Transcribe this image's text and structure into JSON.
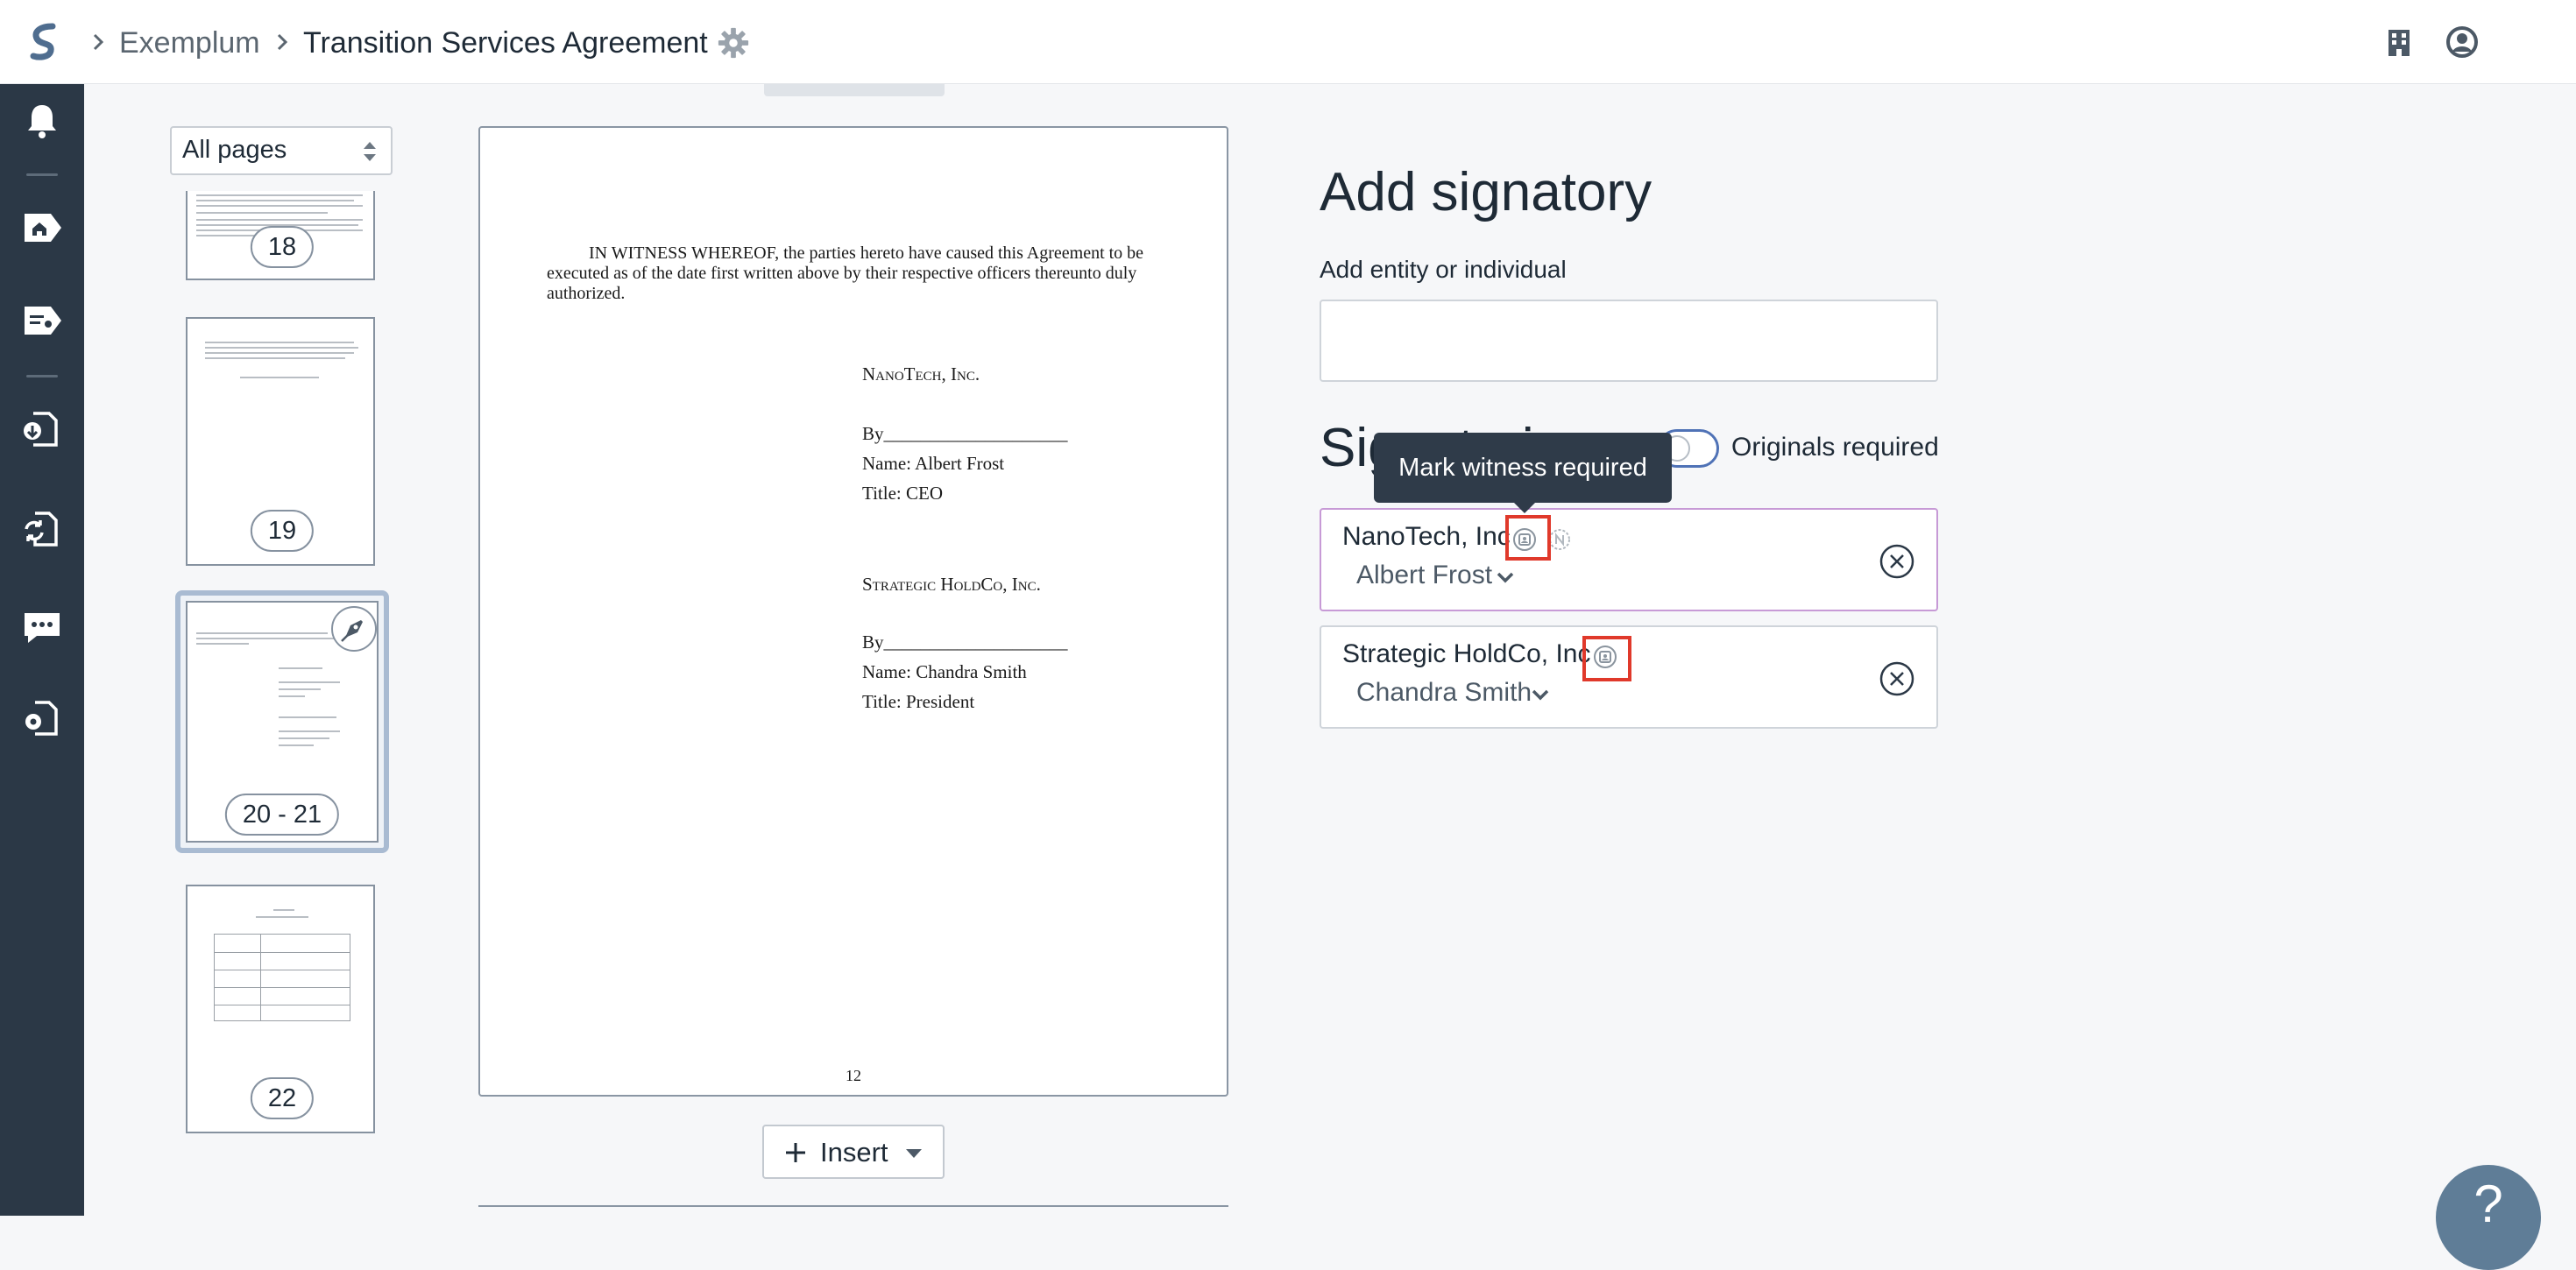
{
  "breadcrumb": {
    "org": "Exemplum",
    "document": "Transition Services Agreement"
  },
  "icons": {
    "logo": "app-logo-icon",
    "settings": "gear-icon",
    "building": "building-icon",
    "account": "user-circle-icon"
  },
  "nav": {
    "items": [
      "bell-icon",
      "home-icon",
      "tag-document-icon",
      "document-download-icon",
      "document-sync-icon",
      "chat-icon",
      "document-settings-icon"
    ]
  },
  "thumbnails": {
    "filter": {
      "selected": "All pages"
    },
    "pages": [
      {
        "label": "18"
      },
      {
        "label": "19"
      },
      {
        "label": "20 - 21"
      },
      {
        "label": "22"
      }
    ]
  },
  "document": {
    "witness_paragraph": "IN WITNESS WHEREOF, the parties hereto have caused this Agreement to be executed as of the date first written above by their respective officers thereunto duly authorized.",
    "party1": {
      "name": "NanoTech, Inc.",
      "by": "By____________________",
      "signer": "Name: Albert Frost",
      "title": "Title: CEO"
    },
    "party2": {
      "name": "Strategic HoldCo, Inc.",
      "by": "By____________________",
      "signer": "Name: Chandra Smith",
      "title": "Title: President"
    },
    "page_number": "12"
  },
  "insert_button": {
    "label": "Insert"
  },
  "panel": {
    "title": "Add signatory",
    "entity_label": "Add entity or individual",
    "entity_value": "",
    "signatories_title": "Signatories",
    "originals_label": "Originals required",
    "originals_required": false,
    "tooltip": "Mark witness required",
    "signatories": [
      {
        "entity": "NanoTech, Inc",
        "person": "Albert Frost"
      },
      {
        "entity": "Strategic HoldCo, Inc",
        "person": "Chandra Smith"
      }
    ]
  },
  "help": {
    "label": "?"
  },
  "colors": {
    "nav_bg": "#2b3846",
    "accent": "#4f72b6",
    "highlight": "#e0392b",
    "tooltip_bg": "#2f3b49"
  }
}
